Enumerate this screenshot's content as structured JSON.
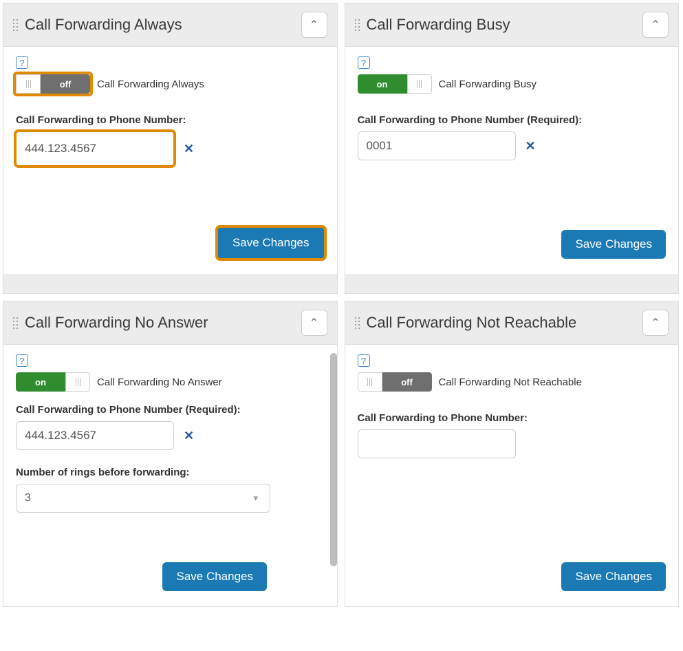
{
  "panels": {
    "always": {
      "title": "Call Forwarding Always",
      "toggle_state": "off",
      "toggle_text": "off",
      "toggle_label": "Call Forwarding Always",
      "phone_label": "Call Forwarding to Phone Number:",
      "phone_value": "444.123.4567",
      "save": "Save Changes"
    },
    "busy": {
      "title": "Call Forwarding Busy",
      "toggle_state": "on",
      "toggle_text": "on",
      "toggle_label": "Call Forwarding Busy",
      "phone_label": "Call Forwarding to Phone Number (Required):",
      "phone_value": "0001",
      "save": "Save Changes"
    },
    "noanswer": {
      "title": "Call Forwarding No Answer",
      "toggle_state": "on",
      "toggle_text": "on",
      "toggle_label": "Call Forwarding No Answer",
      "phone_label": "Call Forwarding to Phone Number (Required):",
      "phone_value": "444.123.4567",
      "rings_label": "Number of rings before forwarding:",
      "rings_value": "3",
      "save": "Save Changes"
    },
    "notreachable": {
      "title": "Call Forwarding Not Reachable",
      "toggle_state": "off",
      "toggle_text": "off",
      "toggle_label": "Call Forwarding Not Reachable",
      "phone_label": "Call Forwarding to Phone Number:",
      "phone_value": "",
      "save": "Save Changes"
    }
  },
  "glyphs": {
    "help": "?",
    "clear": "✕",
    "chevron_up": "⌃",
    "caret_down": "▾"
  }
}
